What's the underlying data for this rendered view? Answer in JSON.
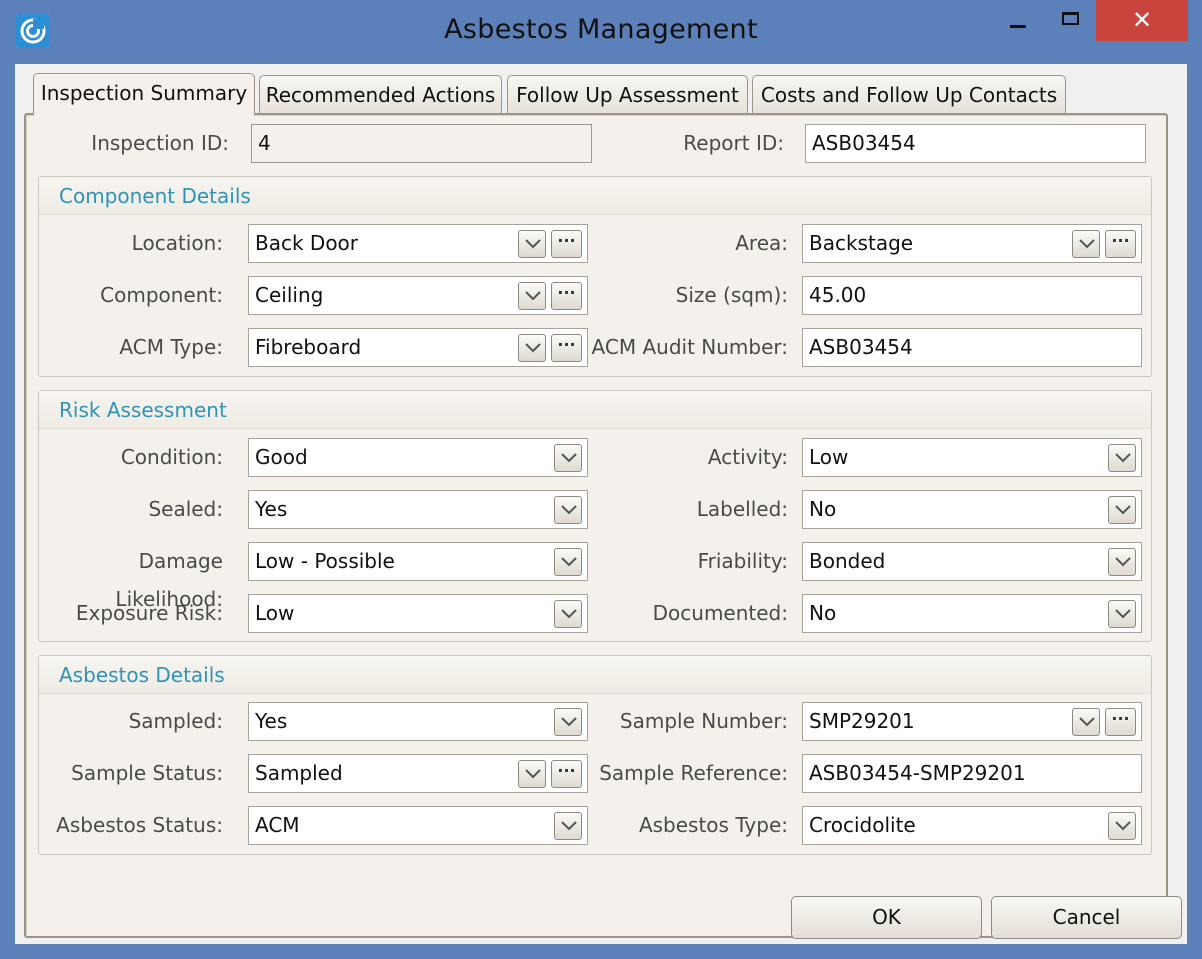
{
  "window": {
    "title": "Asbestos Management",
    "close_glyph": "✕",
    "icon": "app-swirl-icon"
  },
  "tabs": [
    {
      "label": "Inspection Summary",
      "active": true
    },
    {
      "label": "Recommended Actions",
      "active": false
    },
    {
      "label": "Follow Up Assessment",
      "active": false
    },
    {
      "label": "Costs and Follow Up Contacts",
      "active": false
    }
  ],
  "header": {
    "inspection_id_label": "Inspection ID:",
    "inspection_id_value": "4",
    "report_id_label": "Report ID:",
    "report_id_value": "ASB03454"
  },
  "component_details": {
    "title": "Component Details",
    "location_label": "Location:",
    "location_value": "Back Door",
    "area_label": "Area:",
    "area_value": "Backstage",
    "component_label": "Component:",
    "component_value": "Ceiling",
    "size_label": "Size (sqm):",
    "size_value": "45.00",
    "acm_type_label": "ACM Type:",
    "acm_type_value": "Fibreboard",
    "acm_audit_label": "ACM Audit Number:",
    "acm_audit_value": "ASB03454"
  },
  "risk_assessment": {
    "title": "Risk Assessment",
    "condition_label": "Condition:",
    "condition_value": "Good",
    "activity_label": "Activity:",
    "activity_value": "Low",
    "sealed_label": "Sealed:",
    "sealed_value": "Yes",
    "labelled_label": "Labelled:",
    "labelled_value": "No",
    "damage_label": "Damage Likelihood:",
    "damage_value": "Low - Possible",
    "friability_label": "Friability:",
    "friability_value": "Bonded",
    "exposure_label": "Exposure Risk:",
    "exposure_value": "Low",
    "documented_label": "Documented:",
    "documented_value": "No"
  },
  "asbestos_details": {
    "title": "Asbestos Details",
    "sampled_label": "Sampled:",
    "sampled_value": "Yes",
    "sample_number_label": "Sample Number:",
    "sample_number_value": "SMP29201",
    "sample_status_label": "Sample Status:",
    "sample_status_value": "Sampled",
    "sample_reference_label": "Sample Reference:",
    "sample_reference_value": "ASB03454-SMP29201",
    "asbestos_status_label": "Asbestos Status:",
    "asbestos_status_value": "ACM",
    "asbestos_type_label": "Asbestos Type:",
    "asbestos_type_value": "Crocidolite"
  },
  "buttons": {
    "ok": "OK",
    "cancel": "Cancel",
    "ellipsis": "···"
  }
}
